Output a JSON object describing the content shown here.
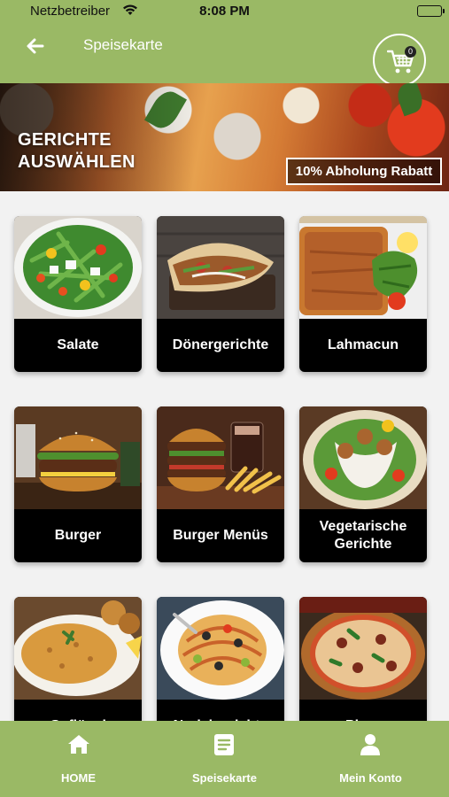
{
  "status_bar": {
    "carrier": "Netzbetreiber",
    "time": "8:08 PM"
  },
  "header": {
    "title": "Speisekarte",
    "cart_count": "0"
  },
  "banner": {
    "headline": "GERICHTE AUSWÄHLEN",
    "promo": "10% Abholung Rabatt"
  },
  "categories": [
    {
      "label": "Salate"
    },
    {
      "label": "Dönergerichte"
    },
    {
      "label": "Lahmacun"
    },
    {
      "label": "Burger"
    },
    {
      "label": "Burger Menüs"
    },
    {
      "label": "Vegetarische Gerichte"
    },
    {
      "label": "Geflügel"
    },
    {
      "label": "Nudelgerichte"
    },
    {
      "label": "Pizza"
    }
  ],
  "bottom_nav": [
    {
      "label": "HOME",
      "icon": "home-icon"
    },
    {
      "label": "Speisekarte",
      "icon": "menu-document-icon"
    },
    {
      "label": "Mein Konto",
      "icon": "person-icon"
    }
  ],
  "colors": {
    "brand_green": "#9ab965",
    "card_label_bg": "#000000"
  }
}
